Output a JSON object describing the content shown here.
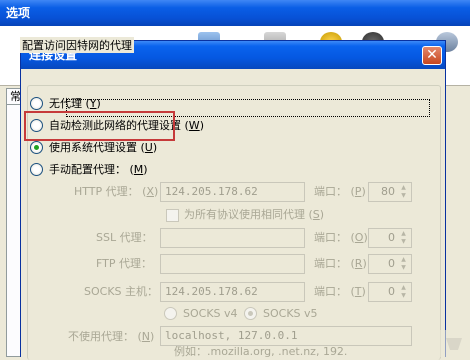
{
  "outer_window": {
    "title": "选项",
    "tab_label": "常规"
  },
  "dialog": {
    "title": "连接设置",
    "close_symbol": "✕",
    "group_title": "配置访问因特网的代理",
    "options": [
      {
        "label": "无代理",
        "key": "Y",
        "checked": false
      },
      {
        "label": "自动检测此网络的代理设置",
        "key": "W",
        "checked": false
      },
      {
        "label": "使用系统代理设置",
        "key": "U",
        "checked": true
      },
      {
        "label": "手动配置代理：",
        "key": "M",
        "checked": false
      }
    ],
    "manual": {
      "http_label": "HTTP 代理：",
      "http_key": "X",
      "http_value": "124.205.178.62",
      "http_port_label": "端口：",
      "http_port_key": "P",
      "http_port_value": "80",
      "same_proxy_label": "为所有协议使用相同代理",
      "same_proxy_key": "S",
      "ssl_label": "SSL 代理：",
      "ssl_port_label": "端口：",
      "ssl_port_key": "O",
      "ssl_port_value": "0",
      "ftp_label": "FTP 代理：",
      "ftp_port_label": "端口：",
      "ftp_port_key": "R",
      "ftp_port_value": "0",
      "socks_label": "SOCKS 主机：",
      "socks_value": "124.205.178.62",
      "socks_port_label": "端口：",
      "socks_port_key": "T",
      "socks_port_value": "0",
      "socks_v4_label": "SOCKS v4",
      "socks_v5_label": "SOCKS v5",
      "socks_v5_checked": true,
      "no_proxy_label": "不使用代理：",
      "no_proxy_key": "N",
      "no_proxy_value": "localhost, 127.0.0.1",
      "example_text": "例如：.mozilla.org, .net.nz, 192."
    }
  },
  "colors": {
    "title_blue": "#0a5ee6",
    "highlight_red": "#c63a3a",
    "selected_green": "#21a121"
  }
}
